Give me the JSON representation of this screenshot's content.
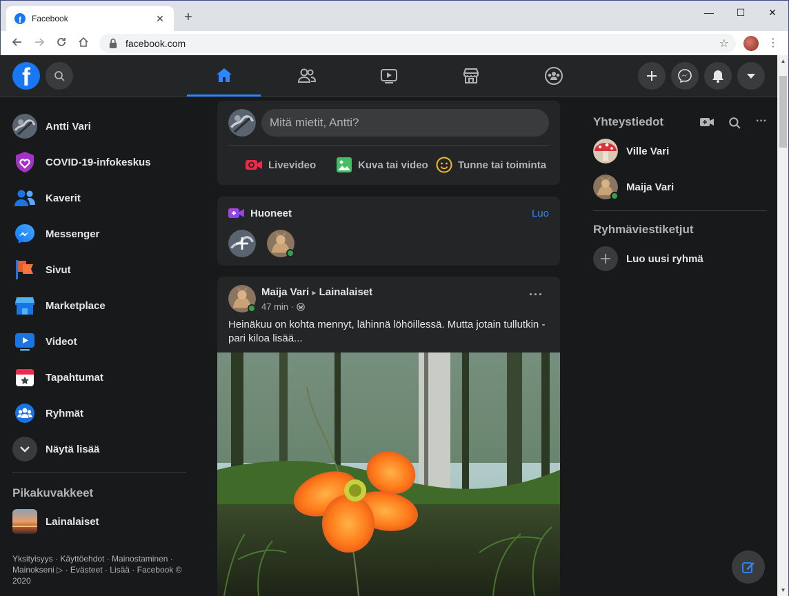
{
  "browser": {
    "tab_title": "Facebook",
    "tab_close": "✕",
    "new_tab": "+",
    "url": "facebook.com",
    "window_minimize": "—",
    "window_maximize": "☐",
    "window_close": "✕"
  },
  "header": {
    "logo_letter": "f",
    "active_tab": "home"
  },
  "sidebar": {
    "items": [
      {
        "label": "Antti Vari",
        "icon": "profile-avatar"
      },
      {
        "label": "COVID-19-infokeskus",
        "icon": "covid-heart-icon"
      },
      {
        "label": "Kaverit",
        "icon": "friends-icon"
      },
      {
        "label": "Messenger",
        "icon": "messenger-icon"
      },
      {
        "label": "Sivut",
        "icon": "pages-flag-icon"
      },
      {
        "label": "Marketplace",
        "icon": "marketplace-icon"
      },
      {
        "label": "Videot",
        "icon": "video-icon"
      },
      {
        "label": "Tapahtumat",
        "icon": "events-icon"
      },
      {
        "label": "Ryhmät",
        "icon": "groups-icon"
      },
      {
        "label": "Näytä lisää",
        "icon": "chevron-down-icon"
      }
    ],
    "shortcuts_title": "Pikakuvakkeet",
    "shortcuts": [
      {
        "label": "Lainalaiset"
      }
    ],
    "footer": "Yksityisyys · Käyttöehdot · Mainostaminen · Mainokseni ▷ · Evästeet · Lisää · Facebook © 2020"
  },
  "composer": {
    "placeholder": "Mitä mietit, Antti?",
    "actions": [
      {
        "label": "Livevideo",
        "color": "#f02849"
      },
      {
        "label": "Kuva tai video",
        "color": "#45bd62"
      },
      {
        "label": "Tunne tai toiminta",
        "color": "#f7b928"
      }
    ]
  },
  "rooms": {
    "title": "Huoneet",
    "create": "Luo"
  },
  "post": {
    "author": "Maija Vari",
    "arrow": "▸",
    "group": "Lainalaiset",
    "time": "47 min ·",
    "more": "···",
    "text": "Heinäkuu on kohta mennyt, lähinnä löhöillessä. Mutta jotain tullutkin - pari kiloa lisää..."
  },
  "contacts": {
    "title": "Yhteystiedot",
    "people": [
      {
        "name": "Ville Vari"
      },
      {
        "name": "Maija Vari"
      }
    ],
    "groups_title": "Ryhmäviestiketjut",
    "new_group": "Luo uusi ryhmä"
  },
  "colors": {
    "accent": "#2d88ff",
    "fb_blue": "#1877f2",
    "online": "#31a24c"
  }
}
